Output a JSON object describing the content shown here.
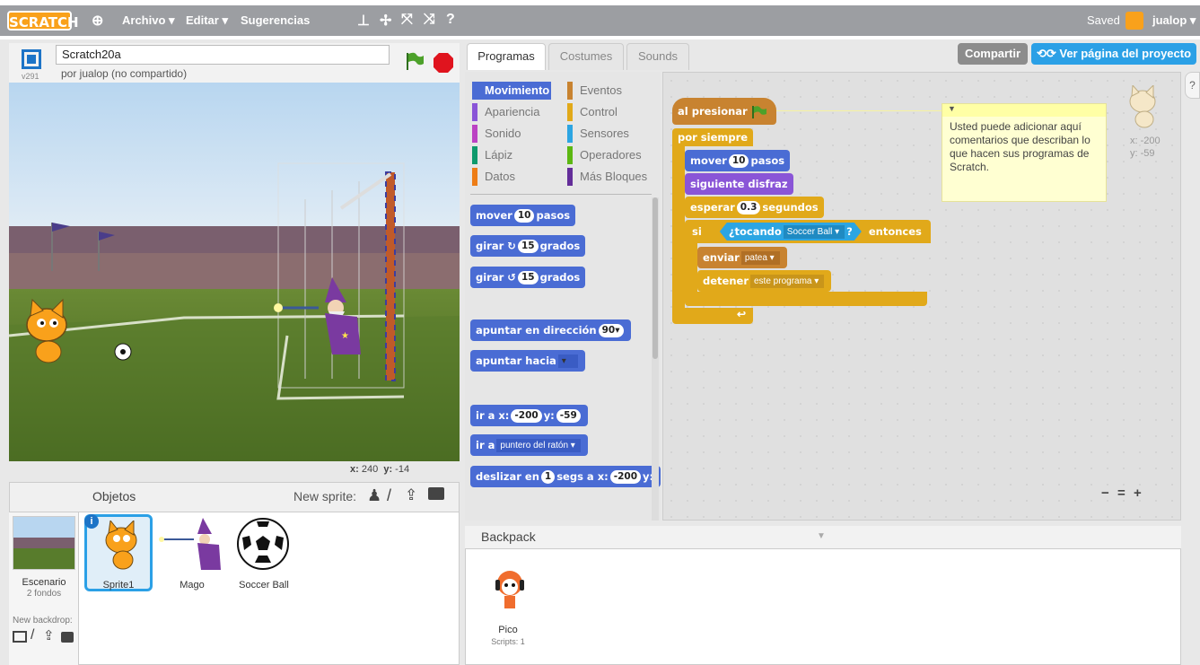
{
  "menubar": {
    "logo": "SCRATCH",
    "file": "Archivo ▾",
    "edit": "Editar ▾",
    "tips": "Sugerencias",
    "saved": "Saved",
    "user": "jualop ▾"
  },
  "stage": {
    "version": "v291",
    "title": "Scratch20a",
    "author": "por jualop (no compartido)",
    "coords_x_label": "x:",
    "coords_x": "240",
    "coords_y_label": "y:",
    "coords_y": "-14"
  },
  "sprites": {
    "header": "Objetos",
    "new_sprite": "New sprite:",
    "stage_label": "Escenario",
    "stage_backdrops": "2 fondos",
    "new_backdrop": "New backdrop:",
    "items": [
      {
        "name": "Sprite1"
      },
      {
        "name": "Mago"
      },
      {
        "name": "Soccer Ball"
      }
    ]
  },
  "tabs": {
    "scripts": "Programas",
    "costumes": "Costumes",
    "sounds": "Sounds"
  },
  "header_buttons": {
    "share": "Compartir",
    "see_page": "Ver página del proyecto"
  },
  "categories": [
    {
      "label": "Movimiento",
      "color": "#4a6cd4"
    },
    {
      "label": "Eventos",
      "color": "#c88330"
    },
    {
      "label": "Apariencia",
      "color": "#8a55d7"
    },
    {
      "label": "Control",
      "color": "#e1a91a"
    },
    {
      "label": "Sonido",
      "color": "#bb42c3"
    },
    {
      "label": "Sensores",
      "color": "#2ca5e2"
    },
    {
      "label": "Lápiz",
      "color": "#0e9a6c"
    },
    {
      "label": "Operadores",
      "color": "#5cb712"
    },
    {
      "label": "Datos",
      "color": "#ee7d16"
    },
    {
      "label": "Más Bloques",
      "color": "#632d99"
    }
  ],
  "palette": {
    "move": "mover",
    "move_n": "10",
    "steps": "pasos",
    "turn": "girar",
    "turn_n": "15",
    "degrees": "grados",
    "turn2_n": "15",
    "point_dir": "apuntar en dirección",
    "dir_n": "90▾",
    "point_towards": "apuntar hacia",
    "goto": "ir a x:",
    "goto_x": "-200",
    "y_label": "y:",
    "goto_y": "-59",
    "goto2": "ir a",
    "mouse": "puntero del ratón ▾",
    "glide": "deslizar en",
    "glide_n": "1",
    "glide_secs": "segs a x:",
    "glide_x": "-200",
    "glide_y": "y:"
  },
  "script": {
    "when_flag": "al presionar",
    "forever": "por siempre",
    "move": "mover",
    "move_n": "10",
    "steps": "pasos",
    "next_costume": "siguiente disfraz",
    "wait": "esperar",
    "wait_n": "0.3",
    "seconds": "segundos",
    "if": "si",
    "touching": "¿tocando",
    "touching_target": "Soccer Ball ▾",
    "q": "?",
    "then": "entonces",
    "broadcast": "enviar",
    "broadcast_msg": "patea ▾",
    "stop": "detener",
    "stop_opt": "este programa ▾"
  },
  "comment": {
    "text": "Usted puede adicionar aquí comentarios que describan lo que hacen sus programas de Scratch."
  },
  "sprite_info": {
    "x": "x: -200",
    "y": "y: -59"
  },
  "zoom": {
    "out": "🔍",
    "reset": "=",
    "in": "🔍"
  },
  "backpack": {
    "title": "Backpack",
    "item_name": "Pico",
    "item_scripts": "Scripts: 1"
  }
}
